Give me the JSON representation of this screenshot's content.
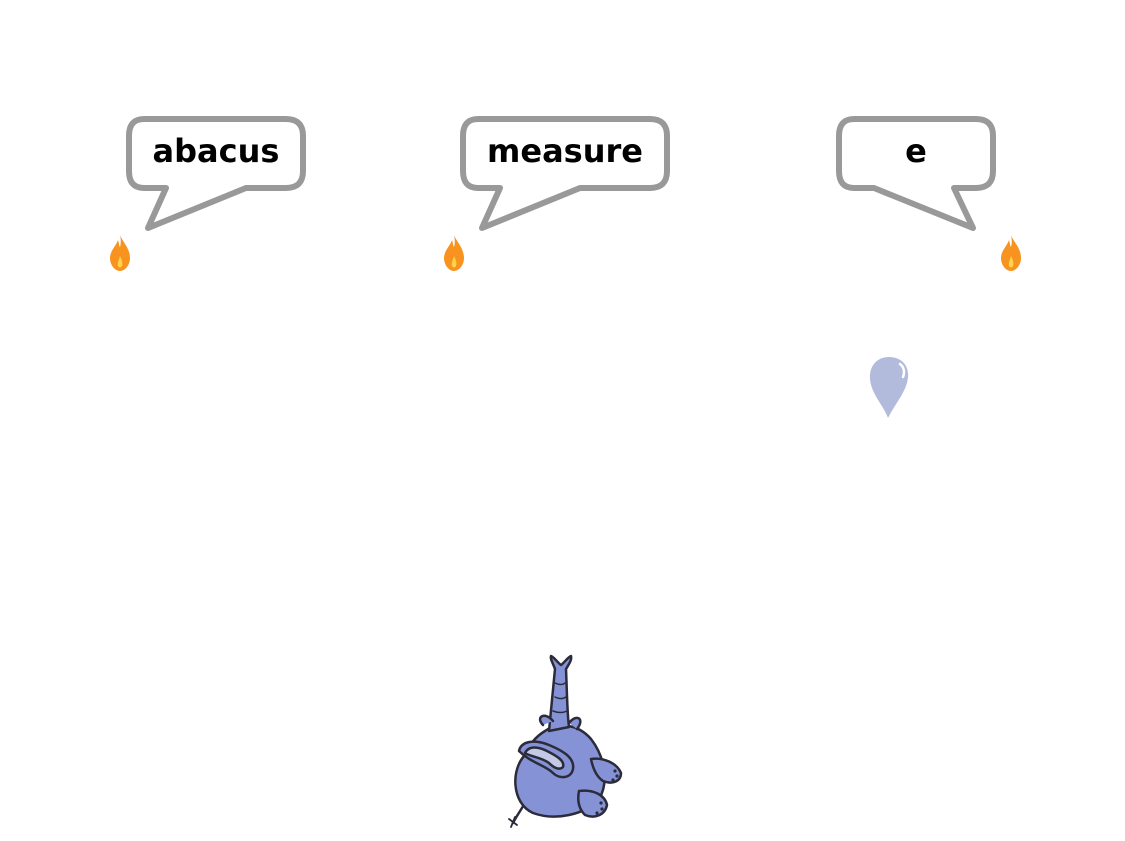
{
  "game": {
    "words": [
      {
        "text": "abacus"
      },
      {
        "text": "measure"
      },
      {
        "text": "e"
      }
    ]
  },
  "sprites": {
    "flames": [
      "flame-icon",
      "flame-icon",
      "flame-icon"
    ],
    "droplet": "water-drop-icon",
    "player": "elephant-icon"
  },
  "colors": {
    "bubble_border": "#999999",
    "bubble_fill": "#ffffff",
    "flame_outer": "#f7931e",
    "flame_inner": "#ffd34d",
    "droplet": "#b3bbdc",
    "elephant": "#8593d6",
    "elephant_outline": "#2b2b3a"
  }
}
